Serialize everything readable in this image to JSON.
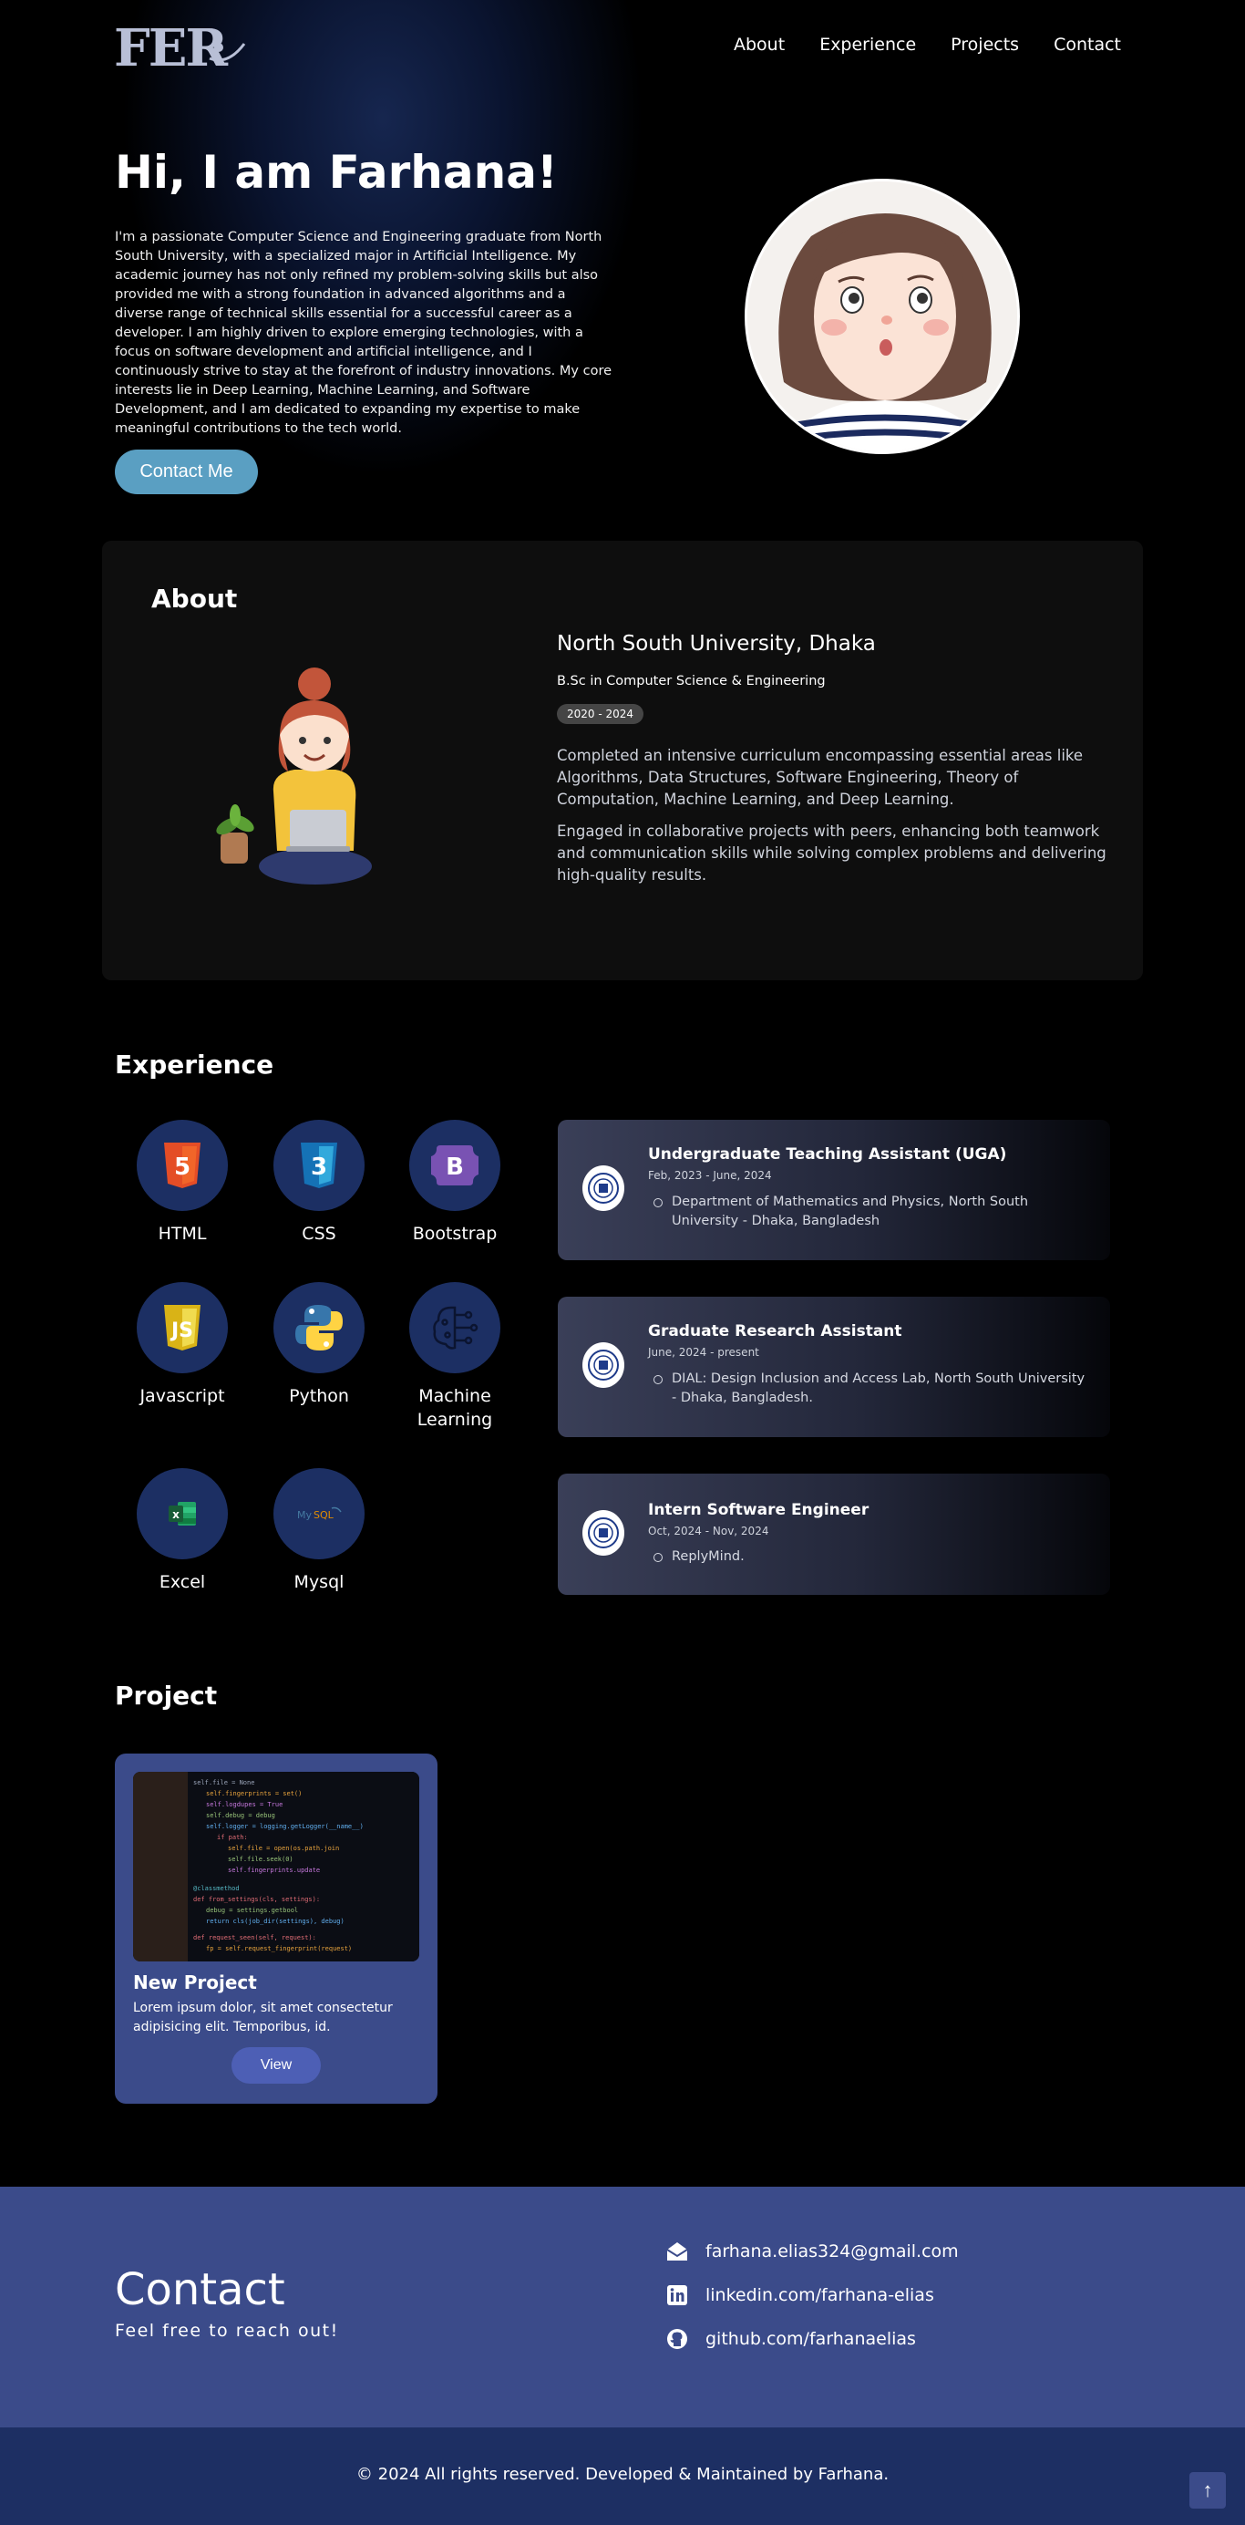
{
  "header": {
    "logo_text": "FER",
    "nav": [
      "About",
      "Experience",
      "Projects",
      "Contact"
    ]
  },
  "hero": {
    "title": "Hi, I am Farhana!",
    "intro": "I'm a passionate Computer Science and Engineering graduate from North South University, with a specialized major in Artificial Intelligence. My academic journey has not only refined my problem-solving skills but also provided me with a strong foundation in advanced algorithms and a diverse range of technical skills essential for a successful career as a developer. I am highly driven to explore emerging technologies, with a focus on software development and artificial intelligence, and I continuously strive to stay at the forefront of industry innovations. My core interests lie in Deep Learning, Machine Learning, and Software Development, and I am dedicated to expanding my expertise to make meaningful contributions to the tech world.",
    "cta_label": "Contact Me"
  },
  "about": {
    "title": "About",
    "university": "North South University, Dhaka",
    "degree": "B.Sc in Computer Science & Engineering",
    "years": "2020 - 2024",
    "paragraphs": [
      "Completed an intensive curriculum encompassing essential areas like Algorithms, Data Structures, Software Engineering, Theory of Computation, Machine Learning, and Deep Learning.",
      "Engaged in collaborative projects with peers, enhancing both teamwork and communication skills while solving complex problems and delivering high-quality results."
    ]
  },
  "experience": {
    "title": "Experience",
    "skills": [
      {
        "label": "HTML",
        "icon": "html5-icon"
      },
      {
        "label": "CSS",
        "icon": "css3-icon"
      },
      {
        "label": "Bootstrap",
        "icon": "bootstrap-icon"
      },
      {
        "label": "Javascript",
        "icon": "javascript-icon"
      },
      {
        "label": "Python",
        "icon": "python-icon"
      },
      {
        "label": "Machine Learning",
        "icon": "machine-learning-icon"
      },
      {
        "label": "Excel",
        "icon": "excel-icon"
      },
      {
        "label": "Mysql",
        "icon": "mysql-icon"
      }
    ],
    "jobs": [
      {
        "role": "Undergraduate Teaching Assistant (UGA)",
        "date": "Feb, 2023 - June, 2024",
        "desc": "Department of Mathematics and Physics, North South University - Dhaka, Bangladesh"
      },
      {
        "role": "Graduate Research Assistant",
        "date": "June, 2024 - present",
        "desc": "DIAL: Design Inclusion and Access Lab, North South University - Dhaka, Bangladesh."
      },
      {
        "role": "Intern Software Engineer",
        "date": "Oct, 2024 - Nov, 2024",
        "desc": "ReplyMind."
      }
    ]
  },
  "projects": {
    "title": "Project",
    "items": [
      {
        "name": "New Project",
        "desc": "Lorem ipsum dolor, sit amet consectetur adipisicing elit. Temporibus, id.",
        "button": "View"
      }
    ]
  },
  "contact": {
    "title": "Contact",
    "subtitle": "Feel free to reach out!",
    "email": "farhana.elias324@gmail.com",
    "linkedin": "linkedin.com/farhana-elias",
    "github": "github.com/farhanaelias"
  },
  "footer": {
    "text": "© 2024 All rights reserved. Developed & Maintained by Farhana.",
    "to_top": "↑"
  },
  "colors": {
    "accent_button": "#5a9fc2",
    "section_blue": "#3b4b8a",
    "footer_blue": "#1d2f63",
    "skill_circle": "#1c2f63"
  }
}
